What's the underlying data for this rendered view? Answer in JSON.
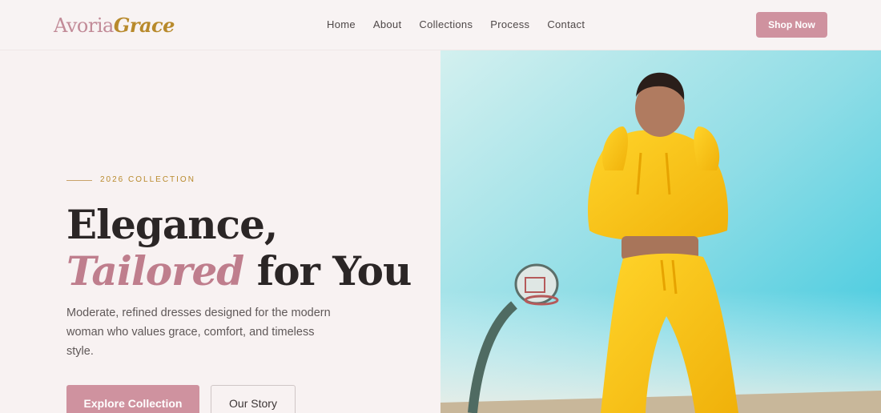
{
  "brand": {
    "name_part1": "Avoria",
    "name_part2": "Grace"
  },
  "nav": {
    "items": [
      {
        "label": "Home"
      },
      {
        "label": "About"
      },
      {
        "label": "Collections"
      },
      {
        "label": "Process"
      },
      {
        "label": "Contact"
      }
    ],
    "cta_label": "Shop Now"
  },
  "hero": {
    "eyebrow": "2026 COLLECTION",
    "headline_line1": "Elegance,",
    "headline_accent": "Tailored",
    "headline_rest": " for You",
    "description": "Moderate, refined dresses designed for the modern woman who values grace, comfort, and timeless style.",
    "primary_button": "Explore Collection",
    "secondary_button": "Our Story",
    "image": {
      "icon": "hero-photo",
      "subject": "woman in yellow tracksuit by basketball hoop"
    }
  },
  "colors": {
    "accent_pink": "#cf929f",
    "accent_gold": "#b88a2c",
    "background": "#f8f2f2",
    "text_dark": "#2b2626"
  }
}
